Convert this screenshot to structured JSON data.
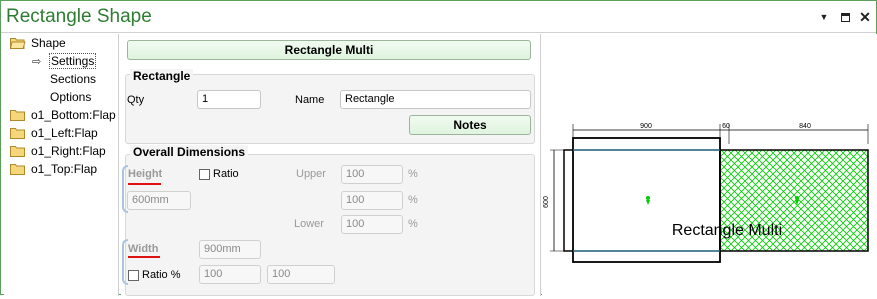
{
  "window": {
    "title": "Rectangle Shape"
  },
  "tree": {
    "items": [
      {
        "label": "Shape",
        "icon": "folder-open-icon"
      },
      {
        "label": "Settings",
        "icon": "arrow-right-icon"
      },
      {
        "label": "Sections"
      },
      {
        "label": "Options"
      },
      {
        "label": "o1_Bottom:Flap",
        "icon": "folder-icon"
      },
      {
        "label": "o1_Left:Flap",
        "icon": "folder-icon"
      },
      {
        "label": "o1_Right:Flap",
        "icon": "folder-icon"
      },
      {
        "label": "o1_Top:Flap",
        "icon": "folder-icon"
      }
    ]
  },
  "header_button": "Rectangle Multi",
  "rectangle_group": {
    "title": "Rectangle",
    "qty_label": "Qty",
    "qty_value": "1",
    "name_label": "Name",
    "name_value": "Rectangle",
    "notes_button": "Notes"
  },
  "dimensions_group": {
    "title": "Overall Dimensions",
    "height_label": "Height",
    "height_value": "600mm",
    "ratio_label": "Ratio",
    "upper_label": "Upper",
    "upper_value": "100",
    "mid_value": "100",
    "lower_label": "Lower",
    "lower_value": "100",
    "percent": "%",
    "width_label": "Width",
    "width_value": "900mm",
    "ratio_pct_label": "Ratio %",
    "ratio_pct_value1": "100",
    "ratio_pct_value2": "100"
  },
  "preview": {
    "dim_900": "900",
    "dim_60": "60",
    "dim_840": "840",
    "dim_600": "600",
    "label": "Rectangle Multi",
    "colors": {
      "hatch": "#00cc00",
      "outline": "#000000",
      "accent": "#2e7d32"
    }
  }
}
